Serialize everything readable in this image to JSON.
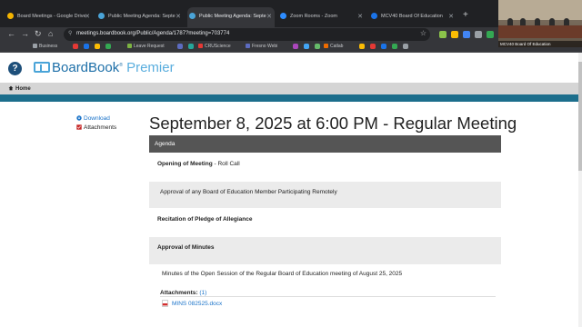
{
  "browser": {
    "tabs": [
      {
        "label": "Board Meetings - Google Drive",
        "color": "#f4b400"
      },
      {
        "label": "Public Meeting Agenda: Septe",
        "color": "#4aa4d8"
      },
      {
        "label": "Public Meeting Agenda: Septe",
        "color": "#4aa4d8",
        "active": true
      },
      {
        "label": "Zoom Rooms - Zoom",
        "color": "#2d8cff"
      },
      {
        "label": "MCV40 Board Of Education",
        "color": "#1a73e8"
      }
    ],
    "new_tab": "+",
    "url": "meetings.boardbook.org/Public/Agenda/1787?meeting=703774",
    "bookmarks": [
      {
        "label": "Business",
        "color": "#9aa0a6"
      },
      {
        "label": "Leave Request",
        "color": "#7cb342"
      },
      {
        "label": "CRUScience",
        "color": "#e53935"
      },
      {
        "label": "Fresno Webi",
        "color": "#5c6bc0"
      },
      {
        "label": "Catlab",
        "color": "#ef6c00"
      }
    ]
  },
  "webcam": {
    "caption": "MCV40 Board Of Education"
  },
  "page": {
    "help": "?",
    "brand_main": "BoardBook",
    "brand_premier": "Premier",
    "nav_home": "Home",
    "side": {
      "download": "Download",
      "attachments": "Attachments"
    },
    "title": "September 8, 2025 at 6:00 PM - Regular Meeting",
    "agenda_header": "Agenda",
    "items": {
      "opening_bold": "Opening of Meeting",
      "opening_rest": " - Roll Call",
      "remote": "Approval of any Board of Education Member Participating Remotely",
      "pledge": "Recitation of Pledge of Allegiance",
      "minutes_bold": "Approval of Minutes",
      "minutes_desc": "Minutes of the Open Session of the Regular Board of Education meeting of August 25, 2025"
    },
    "attachments_label": "Attachments:",
    "attachments_count": "(1)",
    "file_name": "MINS 082525.docx"
  }
}
